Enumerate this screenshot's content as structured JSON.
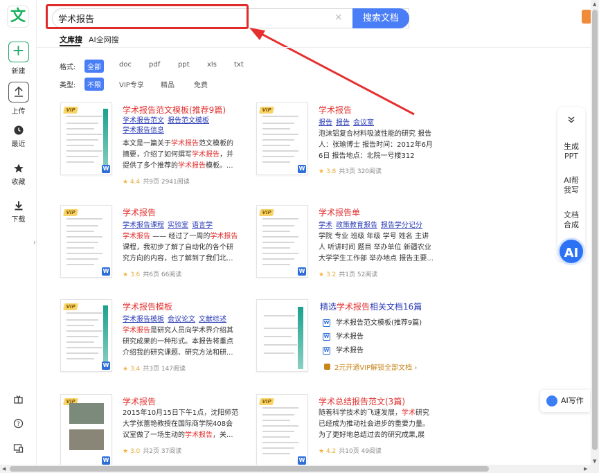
{
  "logo": "文",
  "sidebar": {
    "items": [
      {
        "label": "新建",
        "icon": "plus-icon"
      },
      {
        "label": "上传",
        "icon": "upload-icon"
      },
      {
        "label": "最近",
        "icon": "clock-icon"
      },
      {
        "label": "收藏",
        "icon": "star-icon"
      },
      {
        "label": "下载",
        "icon": "download-icon"
      }
    ],
    "bottom_icons": [
      "gift-icon",
      "help-icon",
      "device-icon"
    ]
  },
  "search": {
    "value": "学术报告",
    "button_label": "搜索文档",
    "clear_icon": "×"
  },
  "tabs": [
    {
      "label": "文库搜",
      "active": true
    },
    {
      "label": "AI全网搜",
      "active": false
    }
  ],
  "filters": {
    "format": {
      "label": "格式:",
      "options": [
        "全部",
        "doc",
        "pdf",
        "ppt",
        "xls",
        "txt"
      ],
      "active": "全部"
    },
    "type": {
      "label": "类型:",
      "options": [
        "不限",
        "VIP专享",
        "精品",
        "免费"
      ],
      "active": "不限"
    }
  },
  "results": [
    {
      "title": "学术报告范文模板(推荐9篇)",
      "tags": [
        "学术报告范文",
        "报告范文模板",
        "学术报告信息"
      ],
      "desc_parts": [
        [
          "本文是一篇关于",
          false
        ],
        [
          "学术报告",
          true
        ],
        [
          "范文模板的摘要，介绍了如何撰写",
          false
        ],
        [
          "学术报告",
          true
        ],
        [
          "，并提供了多个推荐的",
          false
        ],
        [
          "学术报告",
          true
        ],
        [
          "模板。...",
          false
        ]
      ],
      "rating": "4.4",
      "pages": "共9页",
      "reads": "2941阅读"
    },
    {
      "title": "学术报告",
      "tags": [
        "报告",
        "报告",
        "会议室"
      ],
      "desc_parts": [
        [
          "泡沫铝复合材料吸波性能的研究 报告人：张瑜博士 报告时间：2012年6月6日 报告地点：北院一号楼312 201...",
          false
        ]
      ],
      "rating": "3.8",
      "pages": "共3页",
      "reads": "320阅读"
    },
    {
      "title": "学术报告",
      "tags": [
        "学术报告课程",
        "实验室",
        "语言学"
      ],
      "desc_parts": [
        [
          "学术报告",
          true
        ],
        [
          " —— 经过了一周的",
          false
        ],
        [
          "学术报告",
          true
        ],
        [
          "课程，我初步了解了自动化的各个研究方向的内容，也了解到了我们北...",
          false
        ]
      ],
      "rating": "3.6",
      "pages": "共6页",
      "reads": "66阅读"
    },
    {
      "title": "学术报告单",
      "tags": [
        "学术",
        "政策教育报告",
        "报告学分记分"
      ],
      "desc_parts": [
        [
          "学院 专业 班级 年级 学号 姓名 主讲人 听讲时间 题目 举办单位 新疆农业大学学生工作部 举办地点 报告主要...",
          false
        ]
      ],
      "rating": "3.2",
      "pages": "共1页",
      "reads": "52阅读"
    },
    {
      "title": "学术报告模板",
      "tags": [
        "学术报告模板",
        "会议论文",
        "文献综述"
      ],
      "desc_parts": [
        [
          "学术报告",
          true
        ],
        [
          "是研究人员向学术界介绍其研究成果的一种形式。本报告将重点介绍我的研究课题、研究方法和研...",
          false
        ]
      ],
      "rating": "3.4",
      "pages": "共3页",
      "reads": "147阅读"
    },
    {
      "title": "学术报告",
      "tags": [],
      "desc_parts": [
        [
          "2015年10月15日下午1点，沈阳师范大学张蕾艳教授在国际商学院408会议室做了一场生动的",
          false
        ],
        [
          "学术报告",
          true
        ],
        [
          "，关...",
          false
        ]
      ],
      "rating": "3.0",
      "pages": "共2页",
      "reads": "37阅读"
    },
    {
      "title": "学术总结报告范文(3篇)",
      "tags": [],
      "desc_parts": [
        [
          "随着科学技术的飞速发展，",
          false
        ],
        [
          "学术",
          true
        ],
        [
          "研究已经成为推动社会进步的重要力量。为了更好地总结过去的研究成果,展望...",
          false
        ]
      ],
      "rating": "4.2",
      "pages": "共10页",
      "reads": "49阅读"
    }
  ],
  "related": {
    "title_prefix": "精选",
    "title_highlight": "学术报告",
    "title_suffix": "相关文档16篇",
    "items": [
      "学术报告范文模板(推荐9篇)",
      "学术报告",
      "学术报告"
    ],
    "vip_text": "2元开通VIP解锁全部文档 ›"
  },
  "right_panel": {
    "items": [
      "生成PPT",
      "AI帮我写",
      "文档合成"
    ],
    "ai_button": "AI",
    "ai_write": "AI写作"
  },
  "colors": {
    "accent": "#4a7ef6",
    "highlight_red": "#e12a2a",
    "keyword_red": "#e0312f",
    "link_blue": "#2a3bb5",
    "brand_green": "#18b05c"
  }
}
